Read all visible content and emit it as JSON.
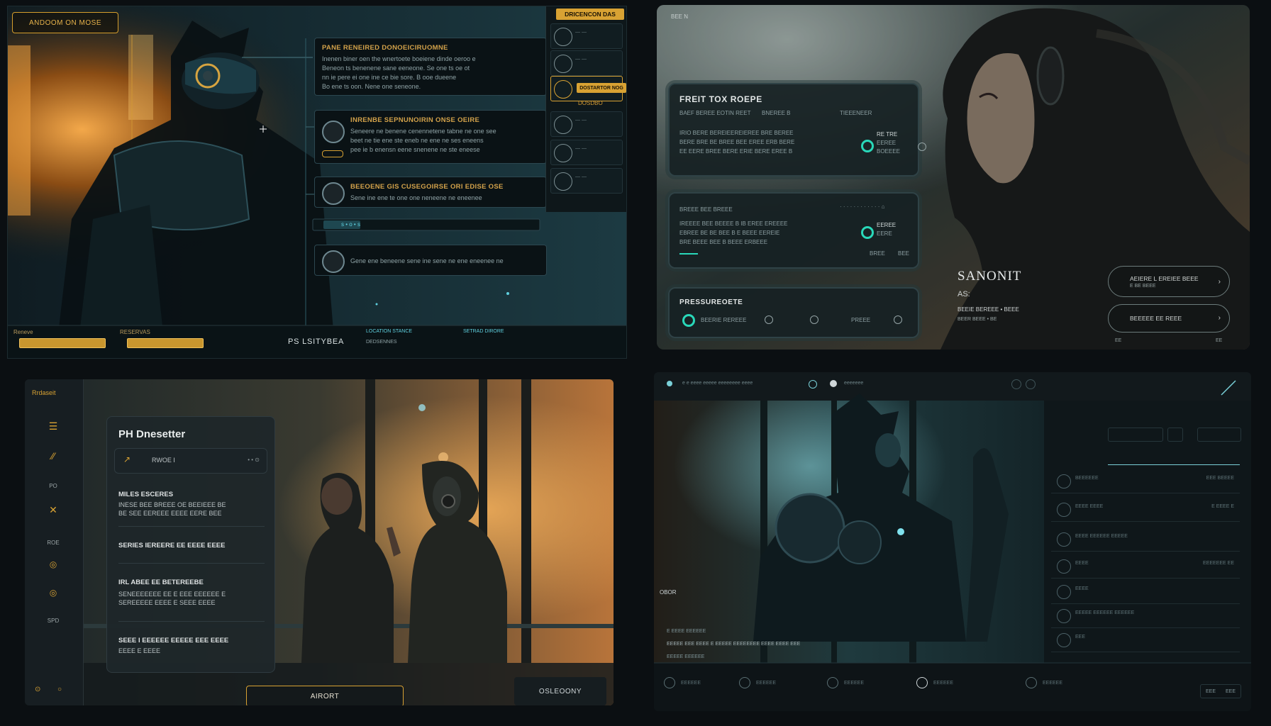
{
  "panel_a": {
    "caption": "ANDOOM ON MOSE",
    "top_chip": "DRICENCON DAS",
    "side_chip": "DOSTARTOR NOG",
    "side_label": "DOSDBO",
    "cards": [
      {
        "title": "PANE RENEIRED DONOEICIRUOMNE",
        "body": [
          "Inenen biner oen the wnertoete boeiene dinde oeroo e",
          "Beneon ts benenene sane eeneone. Se one ts oe ot",
          "nn ie pere ei one ine ce bie sore. B ooe dueene",
          "Bo ene ts oon. Nene one seneone."
        ]
      },
      {
        "title": "INRENBE SEPNUNOIRIN ONSE OEIRE",
        "body": [
          "Seneere ne benene cenennetene tabne ne one see",
          "beet ne tie ene ste eneb ne ene ne ses eneens",
          "pee ie b enensn eene snenene ne ste eneese"
        ]
      },
      {
        "title": "BEEOENE GIS CUSEGOIRSE ORI EDISE OSE",
        "body": [
          "Sene ine ene te one one neneene ne eneenee"
        ]
      },
      {
        "title": "",
        "body": [
          "Gene ene beneene sene ine sene ne ene eneenee ne"
        ]
      }
    ],
    "progress_bar": {
      "label": "s • o • s",
      "fill": 0.4
    },
    "bottom": {
      "left_label": "Reneve",
      "mid_label": "RESERVAS",
      "title": "PS LSITYBEA",
      "right_heads": [
        "LOCATION STANCE",
        "SETRAD DIRORE"
      ],
      "right_sub": "DEDSENNES"
    },
    "colors": {
      "accent": "#d8a233",
      "frame": "#2c4750"
    }
  },
  "panel_b": {
    "corner": "BEE N",
    "card1": {
      "title": "FREIT TOX ROEPE",
      "sub": [
        "BAEF BEREE EOTIN REET",
        "BNEREE B",
        "TIEEENEER"
      ],
      "body": [
        "IRIO BERE BEREIEEREIEREE BRE BEREE",
        "BERE BRE BE BREE BEE EREE ERB BERE",
        "EE EERE BREE BERE ERIE BERE EREE B"
      ],
      "status": [
        "RE TRE",
        "EEREE",
        "BOEEEE"
      ]
    },
    "card2": {
      "sub": "BREEE BEE BREEE",
      "body": [
        "IREEEE BEE BEEEE B IB EREE EREEEE",
        "EBREE BE BE BEE B E BEEE EEREIE",
        "BRE BEEE BEE B BEEE ERBEEE"
      ],
      "status": [
        "EEREE",
        "EERE"
      ],
      "footer": [
        "BREE",
        "BEE"
      ]
    },
    "card3": {
      "title": "PRESSUREOETE",
      "options": [
        "BEERIE REREEE",
        "",
        "",
        "PREEE"
      ]
    },
    "profile": {
      "name": "SANONIT",
      "sub": "AS:",
      "meta1": "BEEIE BEREEE • BEEE",
      "meta2": "BEER BEEE • BE"
    },
    "pills": [
      {
        "title": "AEIERE L EREIEE BEEE",
        "sub": "E BE BEEE"
      },
      {
        "title": "BEEEEE EE REEE",
        "sub": ""
      }
    ],
    "footer": [
      "EE",
      "EE"
    ],
    "colors": {
      "accent": "#29d8b9"
    }
  },
  "panel_c": {
    "logo": "Rrdaseit",
    "nav_labels": [
      "PO",
      "ROE",
      "SPD"
    ],
    "card_title": "PH Dnesetter",
    "search": {
      "value": "RWOE I",
      "tail": "• • ⊙"
    },
    "items": [
      {
        "title": "MILES ESCERES",
        "body": [
          "INESE BEE BREEE OE BEEIEEE BE",
          "BE SEE EEREEE EEEE EERE BEE"
        ]
      },
      {
        "title": "SERIES IEREERE EE EEEE EEEE",
        "body": []
      },
      {
        "title": "IRL ABEE EE BETEREEBE",
        "body": [
          "SENEEEEEEE EE E EEE EEEEEE E",
          "SEREEEEE EEEE E SEEE EEEE"
        ]
      },
      {
        "title": "SEEE I EEEEEE EEEEE EEE EEEE",
        "body": [
          "EEEE E EEEE"
        ]
      }
    ],
    "buttons": {
      "primary": "AIRORT",
      "secondary": "OSLEOONY"
    },
    "colors": {
      "accent": "#d8a233"
    }
  },
  "panel_d": {
    "top_items": [
      "e e eeee eeeee eeeeeeee eeee",
      "eeeeeee",
      "oeeee"
    ],
    "rows": [
      {
        "left": "BEEEEEE",
        "right": "EEE BEEEE"
      },
      {
        "left": "EEEE EEEE",
        "right": "E EEEE E"
      },
      {
        "left": "EEEE EEEEEE EEEEE",
        "right": ""
      },
      {
        "left": "EEEE",
        "right": "EEEEEEE EE"
      },
      {
        "left": "EEEE",
        "right": ""
      },
      {
        "left": "EEEEE EEEEEE EEEEEE",
        "right": ""
      },
      {
        "left": "EEE",
        "right": ""
      }
    ],
    "caption_head": "OBOR",
    "caption": [
      "E EEEE EEEEEE",
      "EEEEE EEE EEEE E EEEEE EEEEEEEE EEEE EEEE EEE",
      "EEEEE EEEEEE"
    ],
    "nav": [
      "EEEEEE",
      "EEEEEE",
      "EEEEEE",
      "EEEEEE",
      "EEEEEE"
    ],
    "corner": [
      "EEE",
      "EEE"
    ],
    "colors": {
      "accent": "#7ad0d8"
    }
  }
}
